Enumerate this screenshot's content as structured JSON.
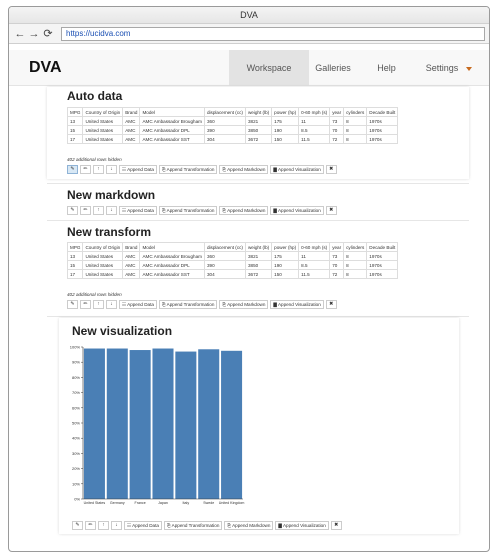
{
  "window": {
    "title": "DVA",
    "url": "https://ucidva.com"
  },
  "nav": {
    "brand": "DVA",
    "items": [
      "Workspace",
      "Galleries",
      "Help",
      "Settings"
    ]
  },
  "table_columns": [
    "MPG",
    "Country of Origin",
    "Brand",
    "Model",
    "displacement (cc)",
    "weight (lb)",
    "power (hp)",
    "0-60 mph (s)",
    "year",
    "cylinders",
    "Decade Built"
  ],
  "sections": {
    "auto": {
      "title": "Auto data",
      "rows": [
        [
          "13",
          "United States",
          "AMC",
          "AMC Ambassador Brougham",
          "360",
          "3821",
          "175",
          "11",
          "73",
          "8",
          "1970s"
        ],
        [
          "15",
          "United States",
          "AMC",
          "AMC Ambassador DPL",
          "390",
          "3850",
          "190",
          "8.5",
          "70",
          "8",
          "1970s"
        ],
        [
          "17",
          "United States",
          "AMC",
          "AMC Ambassador SST",
          "304",
          "3672",
          "150",
          "11.5",
          "72",
          "8",
          "1970s"
        ]
      ],
      "hidden_note": "402 additional rows hidden"
    },
    "markdown": {
      "title": "New markdown"
    },
    "transform": {
      "title": "New transform",
      "rows": [
        [
          "13",
          "United States",
          "AMC",
          "AMC Ambassador Brougham",
          "360",
          "3821",
          "175",
          "11",
          "73",
          "8",
          "1970s"
        ],
        [
          "15",
          "United States",
          "AMC",
          "AMC Ambassador DPL",
          "390",
          "3850",
          "190",
          "8.5",
          "70",
          "8",
          "1970s"
        ],
        [
          "17",
          "United States",
          "AMC",
          "AMC Ambassador SST",
          "304",
          "3672",
          "150",
          "11.5",
          "72",
          "8",
          "1970s"
        ]
      ],
      "hidden_note": "402 additional rows hidden"
    },
    "visualization": {
      "title": "New visualization"
    }
  },
  "toolbar": {
    "append_data": "Append Data",
    "append_transformation": "Append Transformation",
    "append_markdown": "Append Markdown",
    "append_visualization": "Append Visualization",
    "icons": [
      "pencil-icon",
      "edit-icon",
      "arrow-up-icon",
      "arrow-down-icon",
      "close-icon"
    ]
  },
  "colors": {
    "bar": "#4a7fb5",
    "active_nav": "#e3e3e3",
    "caret": "#c76a1e",
    "link": "#1a4fb3"
  },
  "chart_data": {
    "type": "bar",
    "categories": [
      "United States",
      "Germany",
      "France",
      "Japan",
      "Italy",
      "Swede",
      "United Kingdom"
    ],
    "values": [
      99,
      99,
      98,
      99,
      97,
      98.5,
      97.5
    ],
    "ylim": [
      0,
      100
    ],
    "yticks": [
      "0%",
      "10%",
      "20%",
      "30%",
      "40%",
      "50%",
      "60%",
      "70%",
      "80%",
      "90%",
      "100%"
    ],
    "title": "",
    "xlabel": "",
    "ylabel": ""
  }
}
